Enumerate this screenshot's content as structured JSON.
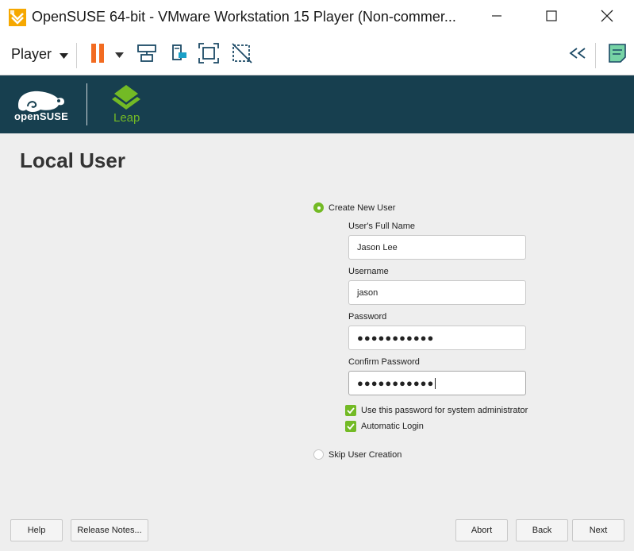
{
  "window": {
    "title": "OpenSUSE 64-bit - VMware Workstation 15 Player (Non-commer...",
    "minimize_icon": "minimize-icon",
    "maximize_icon": "maximize-icon",
    "close_icon": "close-icon"
  },
  "toolbar": {
    "player_label": "Player",
    "icons": [
      "pause-icon",
      "dropdown-arrow-icon",
      "send-ctrl-alt-del-icon",
      "removable-devices-icon",
      "full-screen-icon",
      "unity-icon",
      "collapse-icon",
      "notes-icon"
    ]
  },
  "banner": {
    "brand": "openSUSE",
    "product": "Leap",
    "colors": {
      "background": "#173f4f",
      "accent": "#73ba25"
    }
  },
  "page": {
    "title": "Local User"
  },
  "form": {
    "create_user_option": {
      "label": "Create New User",
      "selected": true
    },
    "full_name": {
      "label": "User's Full Name",
      "value": "Jason Lee"
    },
    "username": {
      "label": "Username",
      "value": "jason"
    },
    "password": {
      "label": "Password",
      "value": "●●●●●●●●●●●"
    },
    "confirm_password": {
      "label": "Confirm Password",
      "value": "●●●●●●●●●●●"
    },
    "use_for_admin": {
      "label": "Use this password for system administrator",
      "checked": true
    },
    "auto_login": {
      "label": "Automatic Login",
      "checked": true
    },
    "skip_option": {
      "label": "Skip User Creation",
      "selected": false
    }
  },
  "buttons": {
    "help": "Help",
    "release_notes": "Release Notes...",
    "abort": "Abort",
    "back": "Back",
    "next": "Next"
  }
}
